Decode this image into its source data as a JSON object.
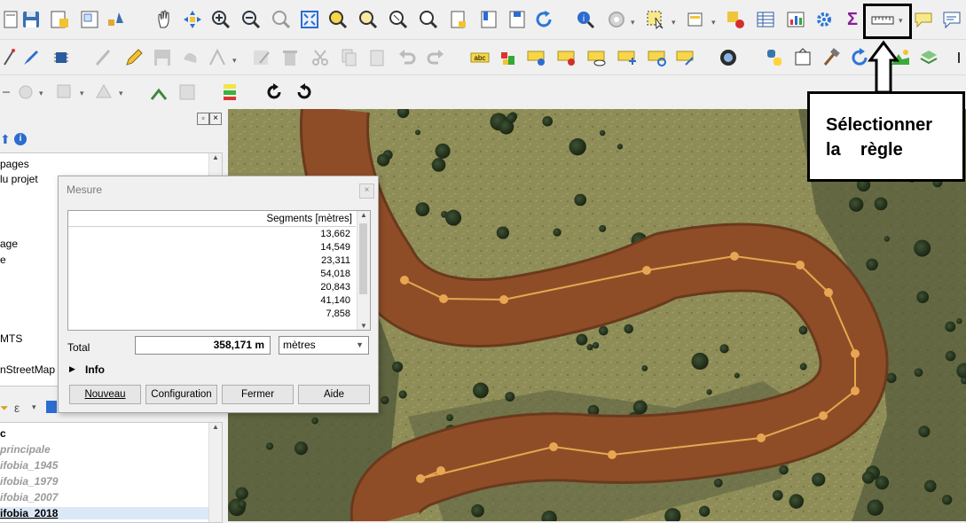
{
  "left_panel": {
    "upper_items": [
      "pages",
      "lu projet",
      "age",
      "e",
      "MTS",
      "nStreetMap"
    ],
    "filter_label": "ε",
    "layers": [
      {
        "label": "c",
        "style": "normal"
      },
      {
        "label": "principale",
        "style": "italic"
      },
      {
        "label": "ifobia_1945",
        "style": "italic"
      },
      {
        "label": "ifobia_1979",
        "style": "italic"
      },
      {
        "label": "ifobia_2007",
        "style": "italic"
      },
      {
        "label": "ifobia_2018",
        "style": "selected"
      }
    ]
  },
  "measure_dialog": {
    "title": "Mesure",
    "column_header": "Segments [mètres]",
    "segments": [
      "13,662",
      "14,549",
      "23,311",
      "54,018",
      "20,843",
      "41,140",
      "7,858"
    ],
    "total_label": "Total",
    "total_value": "358,171 m",
    "unit_selected": "mètres",
    "info_label": "Info",
    "buttons": {
      "new": "Nouveau",
      "config": "Configuration",
      "close": "Fermer",
      "help": "Aide"
    }
  },
  "toolbar": {
    "sum_symbol": "Σ"
  },
  "annotation": {
    "line1": "Sélectionner",
    "line2": "la    règle"
  },
  "colors": {
    "river_fill": "#8f4d27",
    "river_edge": "#6a3a1d",
    "measure_line": "#e6a84e",
    "measure_point": "#e8a653",
    "grass": "#8a8a52",
    "tree_dark": "#24311c"
  }
}
